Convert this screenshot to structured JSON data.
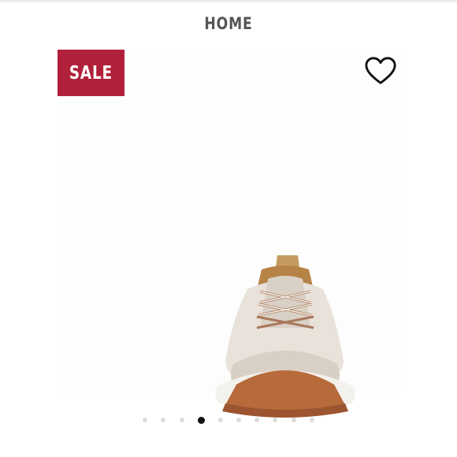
{
  "header": {
    "title": "HOME"
  },
  "badge": {
    "label": "SALE",
    "color": "#b0203a"
  },
  "icons": {
    "wishlist": "heart-outline-icon"
  },
  "carousel": {
    "total_slides": 10,
    "active_index": 3
  }
}
